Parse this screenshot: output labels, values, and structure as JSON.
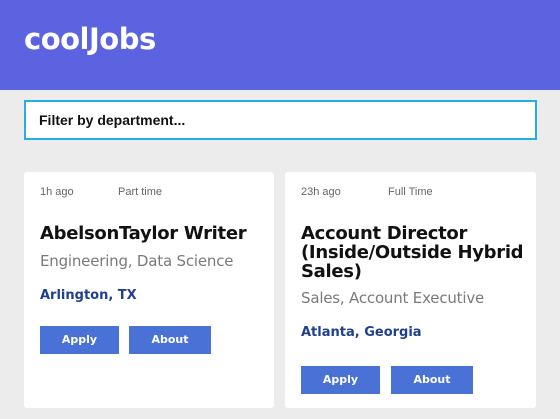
{
  "header": {
    "logo_text": "coolJobs",
    "brand_color": "#5b63e0"
  },
  "filter": {
    "placeholder": "Filter by department..."
  },
  "jobs": [
    {
      "posted": "1h ago",
      "type": "Part time",
      "title": "AbelsonTaylor Writer",
      "department": "Engineering, Data Science",
      "location": "Arlington, TX",
      "apply_label": "Apply",
      "about_label": "About"
    },
    {
      "posted": "23h ago",
      "type": "Full Time",
      "title": "Account Director (Inside/Outside Hybrid Sales)",
      "department": "Sales, Account Executive",
      "location": "Atlanta, Georgia",
      "apply_label": "Apply",
      "about_label": "About"
    }
  ],
  "colors": {
    "accent_border": "#25aee0",
    "button": "#4a72d6",
    "location_text": "#1f3f8f"
  }
}
